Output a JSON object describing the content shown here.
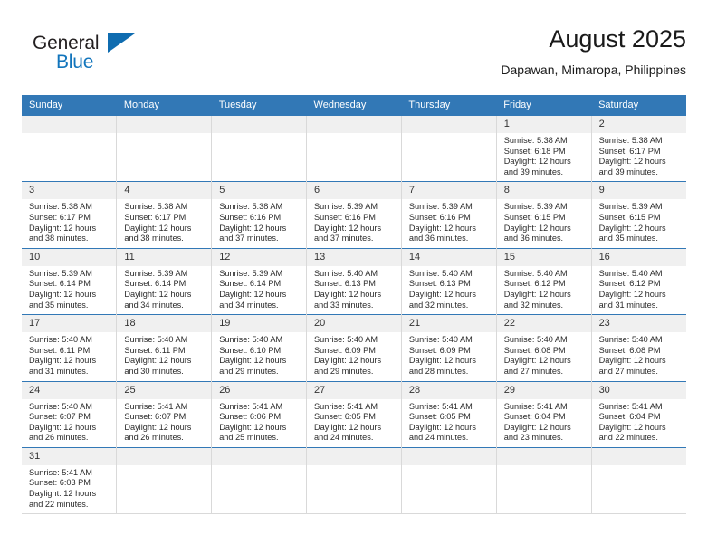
{
  "logo": {
    "word_one": "General",
    "word_two": "Blue",
    "icon": "flag-triangle-icon",
    "accent_color": "#1275bc"
  },
  "header": {
    "title": "August 2025",
    "subtitle": "Dapawan, Mimaropa, Philippines"
  },
  "theme": {
    "header_blue": "#3278b6",
    "date_strip_gray": "#f0f0f0",
    "grid_line": "#d9d9d9"
  },
  "calendar": {
    "weekday_headers": [
      "Sunday",
      "Monday",
      "Tuesday",
      "Wednesday",
      "Thursday",
      "Friday",
      "Saturday"
    ],
    "weeks": [
      [
        {
          "day": "",
          "empty": true
        },
        {
          "day": "",
          "empty": true
        },
        {
          "day": "",
          "empty": true
        },
        {
          "day": "",
          "empty": true
        },
        {
          "day": "",
          "empty": true
        },
        {
          "day": "1",
          "sunrise": "Sunrise: 5:38 AM",
          "sunset": "Sunset: 6:18 PM",
          "daylight_line1": "Daylight: 12 hours",
          "daylight_line2": "and 39 minutes."
        },
        {
          "day": "2",
          "sunrise": "Sunrise: 5:38 AM",
          "sunset": "Sunset: 6:17 PM",
          "daylight_line1": "Daylight: 12 hours",
          "daylight_line2": "and 39 minutes."
        }
      ],
      [
        {
          "day": "3",
          "sunrise": "Sunrise: 5:38 AM",
          "sunset": "Sunset: 6:17 PM",
          "daylight_line1": "Daylight: 12 hours",
          "daylight_line2": "and 38 minutes."
        },
        {
          "day": "4",
          "sunrise": "Sunrise: 5:38 AM",
          "sunset": "Sunset: 6:17 PM",
          "daylight_line1": "Daylight: 12 hours",
          "daylight_line2": "and 38 minutes."
        },
        {
          "day": "5",
          "sunrise": "Sunrise: 5:38 AM",
          "sunset": "Sunset: 6:16 PM",
          "daylight_line1": "Daylight: 12 hours",
          "daylight_line2": "and 37 minutes."
        },
        {
          "day": "6",
          "sunrise": "Sunrise: 5:39 AM",
          "sunset": "Sunset: 6:16 PM",
          "daylight_line1": "Daylight: 12 hours",
          "daylight_line2": "and 37 minutes."
        },
        {
          "day": "7",
          "sunrise": "Sunrise: 5:39 AM",
          "sunset": "Sunset: 6:16 PM",
          "daylight_line1": "Daylight: 12 hours",
          "daylight_line2": "and 36 minutes."
        },
        {
          "day": "8",
          "sunrise": "Sunrise: 5:39 AM",
          "sunset": "Sunset: 6:15 PM",
          "daylight_line1": "Daylight: 12 hours",
          "daylight_line2": "and 36 minutes."
        },
        {
          "day": "9",
          "sunrise": "Sunrise: 5:39 AM",
          "sunset": "Sunset: 6:15 PM",
          "daylight_line1": "Daylight: 12 hours",
          "daylight_line2": "and 35 minutes."
        }
      ],
      [
        {
          "day": "10",
          "sunrise": "Sunrise: 5:39 AM",
          "sunset": "Sunset: 6:14 PM",
          "daylight_line1": "Daylight: 12 hours",
          "daylight_line2": "and 35 minutes."
        },
        {
          "day": "11",
          "sunrise": "Sunrise: 5:39 AM",
          "sunset": "Sunset: 6:14 PM",
          "daylight_line1": "Daylight: 12 hours",
          "daylight_line2": "and 34 minutes."
        },
        {
          "day": "12",
          "sunrise": "Sunrise: 5:39 AM",
          "sunset": "Sunset: 6:14 PM",
          "daylight_line1": "Daylight: 12 hours",
          "daylight_line2": "and 34 minutes."
        },
        {
          "day": "13",
          "sunrise": "Sunrise: 5:40 AM",
          "sunset": "Sunset: 6:13 PM",
          "daylight_line1": "Daylight: 12 hours",
          "daylight_line2": "and 33 minutes."
        },
        {
          "day": "14",
          "sunrise": "Sunrise: 5:40 AM",
          "sunset": "Sunset: 6:13 PM",
          "daylight_line1": "Daylight: 12 hours",
          "daylight_line2": "and 32 minutes."
        },
        {
          "day": "15",
          "sunrise": "Sunrise: 5:40 AM",
          "sunset": "Sunset: 6:12 PM",
          "daylight_line1": "Daylight: 12 hours",
          "daylight_line2": "and 32 minutes."
        },
        {
          "day": "16",
          "sunrise": "Sunrise: 5:40 AM",
          "sunset": "Sunset: 6:12 PM",
          "daylight_line1": "Daylight: 12 hours",
          "daylight_line2": "and 31 minutes."
        }
      ],
      [
        {
          "day": "17",
          "sunrise": "Sunrise: 5:40 AM",
          "sunset": "Sunset: 6:11 PM",
          "daylight_line1": "Daylight: 12 hours",
          "daylight_line2": "and 31 minutes."
        },
        {
          "day": "18",
          "sunrise": "Sunrise: 5:40 AM",
          "sunset": "Sunset: 6:11 PM",
          "daylight_line1": "Daylight: 12 hours",
          "daylight_line2": "and 30 minutes."
        },
        {
          "day": "19",
          "sunrise": "Sunrise: 5:40 AM",
          "sunset": "Sunset: 6:10 PM",
          "daylight_line1": "Daylight: 12 hours",
          "daylight_line2": "and 29 minutes."
        },
        {
          "day": "20",
          "sunrise": "Sunrise: 5:40 AM",
          "sunset": "Sunset: 6:09 PM",
          "daylight_line1": "Daylight: 12 hours",
          "daylight_line2": "and 29 minutes."
        },
        {
          "day": "21",
          "sunrise": "Sunrise: 5:40 AM",
          "sunset": "Sunset: 6:09 PM",
          "daylight_line1": "Daylight: 12 hours",
          "daylight_line2": "and 28 minutes."
        },
        {
          "day": "22",
          "sunrise": "Sunrise: 5:40 AM",
          "sunset": "Sunset: 6:08 PM",
          "daylight_line1": "Daylight: 12 hours",
          "daylight_line2": "and 27 minutes."
        },
        {
          "day": "23",
          "sunrise": "Sunrise: 5:40 AM",
          "sunset": "Sunset: 6:08 PM",
          "daylight_line1": "Daylight: 12 hours",
          "daylight_line2": "and 27 minutes."
        }
      ],
      [
        {
          "day": "24",
          "sunrise": "Sunrise: 5:40 AM",
          "sunset": "Sunset: 6:07 PM",
          "daylight_line1": "Daylight: 12 hours",
          "daylight_line2": "and 26 minutes."
        },
        {
          "day": "25",
          "sunrise": "Sunrise: 5:41 AM",
          "sunset": "Sunset: 6:07 PM",
          "daylight_line1": "Daylight: 12 hours",
          "daylight_line2": "and 26 minutes."
        },
        {
          "day": "26",
          "sunrise": "Sunrise: 5:41 AM",
          "sunset": "Sunset: 6:06 PM",
          "daylight_line1": "Daylight: 12 hours",
          "daylight_line2": "and 25 minutes."
        },
        {
          "day": "27",
          "sunrise": "Sunrise: 5:41 AM",
          "sunset": "Sunset: 6:05 PM",
          "daylight_line1": "Daylight: 12 hours",
          "daylight_line2": "and 24 minutes."
        },
        {
          "day": "28",
          "sunrise": "Sunrise: 5:41 AM",
          "sunset": "Sunset: 6:05 PM",
          "daylight_line1": "Daylight: 12 hours",
          "daylight_line2": "and 24 minutes."
        },
        {
          "day": "29",
          "sunrise": "Sunrise: 5:41 AM",
          "sunset": "Sunset: 6:04 PM",
          "daylight_line1": "Daylight: 12 hours",
          "daylight_line2": "and 23 minutes."
        },
        {
          "day": "30",
          "sunrise": "Sunrise: 5:41 AM",
          "sunset": "Sunset: 6:04 PM",
          "daylight_line1": "Daylight: 12 hours",
          "daylight_line2": "and 22 minutes."
        }
      ],
      [
        {
          "day": "31",
          "sunrise": "Sunrise: 5:41 AM",
          "sunset": "Sunset: 6:03 PM",
          "daylight_line1": "Daylight: 12 hours",
          "daylight_line2": "and 22 minutes."
        },
        {
          "day": "",
          "empty": true
        },
        {
          "day": "",
          "empty": true
        },
        {
          "day": "",
          "empty": true
        },
        {
          "day": "",
          "empty": true
        },
        {
          "day": "",
          "empty": true
        },
        {
          "day": "",
          "empty": true
        }
      ]
    ]
  }
}
